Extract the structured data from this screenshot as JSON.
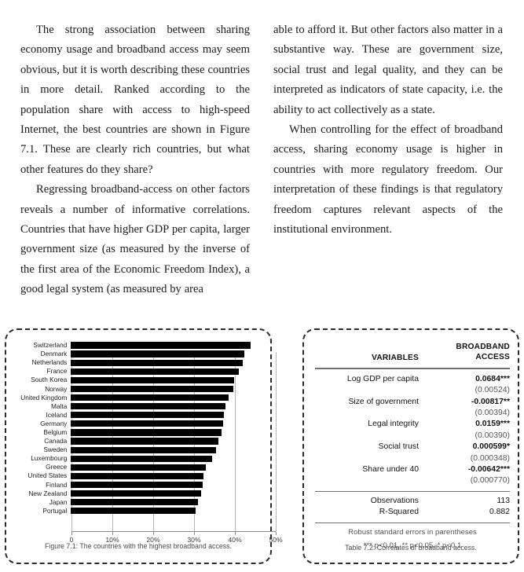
{
  "body_text": {
    "left_column": [
      "The strong association between sharing economy usage and broadband access may seem obvious, but it is worth describing these countries in more detail. Ranked according to the population share with access to high-speed Internet, the best countries are shown in Figure 7.1. These are clearly rich countries, but what other features do they share?",
      "Regressing broadband-access on other factors reveals a number of informative correlations. Countries that have higher GDP per capita, larger government size (as measured by the inverse of the first area of the Economic Freedom Index), a good legal system (as measured by area"
    ],
    "right_column": [
      "able to afford it. But other factors also matter in a substantive way. These are government size, social trust and legal quality, and they can be interpreted as indicators of state capacity, i.e. the ability to act collectively as a state.",
      "When controlling for the effect of broadband access, sharing economy usage is higher in countries with more regulatory freedom. Our interpretation of these findings is that regulatory freedom captures relevant aspects of the institutional environment."
    ]
  },
  "figure": {
    "caption": "Figure 7.1: The countries with the highest broadband access."
  },
  "chart_data": {
    "type": "bar",
    "orientation": "horizontal",
    "title": "",
    "xlabel": "",
    "ylabel": "",
    "xlim": [
      0,
      50
    ],
    "grid": true,
    "legend": false,
    "tick_labels": [
      "0",
      "10%",
      "20%",
      "30%",
      "40%",
      "50%"
    ],
    "tick_values": [
      0,
      10,
      20,
      30,
      40,
      50
    ],
    "categories": [
      "Switzerland",
      "Denmark",
      "Netherlands",
      "France",
      "South Korea",
      "Norway",
      "United Kingdom",
      "Malta",
      "Iceland",
      "Germany",
      "Belgium",
      "Canada",
      "Sweden",
      "Luxembourg",
      "Greece",
      "United States",
      "Finland",
      "New Zealand",
      "Japan",
      "Portugal"
    ],
    "values": [
      44.0,
      42.5,
      42.0,
      41.0,
      40.0,
      39.8,
      38.5,
      37.8,
      37.5,
      37.2,
      36.8,
      36.0,
      35.5,
      34.5,
      33.0,
      32.5,
      32.2,
      31.8,
      31.0,
      30.5
    ],
    "bar_color": "#000000"
  },
  "table": {
    "caption": "Table 7.2: Correlates of broadband access.",
    "header": {
      "col1": "VARIABLES",
      "col2_line1": "BROADBAND",
      "col2_line2": "ACCESS"
    },
    "rows": [
      {
        "variable": "Log GDP per capita",
        "coef": "0.0684***",
        "se": "(0.00524)"
      },
      {
        "variable": "Size of government",
        "coef": "-0.00817**",
        "se": "(0.00394)"
      },
      {
        "variable": "Legal integrity",
        "coef": "0.0159***",
        "se": "(0.00390)"
      },
      {
        "variable": "Social trust",
        "coef": "0.000599*",
        "se": "(0.000348)"
      },
      {
        "variable": "Share under 40",
        "coef": "-0.00642***",
        "se": "(0.000770)"
      }
    ],
    "stats": [
      {
        "label": "Observations",
        "value": "113"
      },
      {
        "label": "R-Squared",
        "value": "0.882"
      }
    ],
    "notes": [
      "Robust standard errors in parentheses",
      "*** p<0.01, ** p<0.05, * p<0.1"
    ]
  }
}
